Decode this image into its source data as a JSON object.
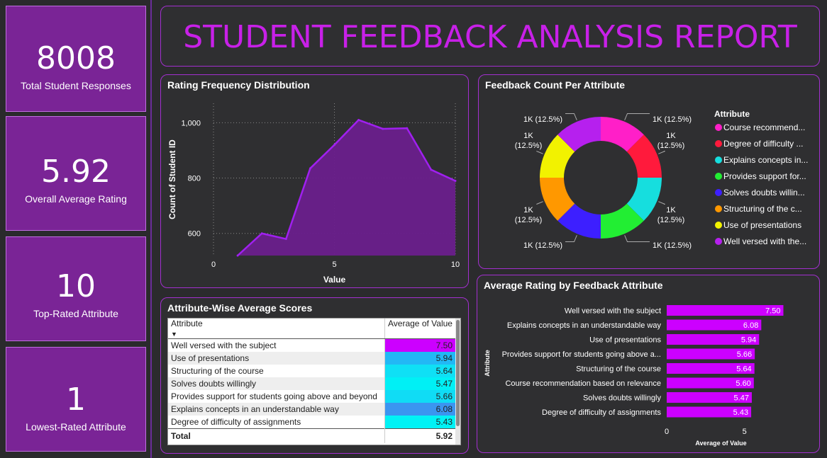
{
  "kpis": [
    {
      "value": "8008",
      "label": "Total Student Responses"
    },
    {
      "value": "5.92",
      "label": "Overall Average Rating"
    },
    {
      "value": "10",
      "label": "Top-Rated Attribute"
    },
    {
      "value": "1",
      "label": "Lowest-Rated Attribute"
    }
  ],
  "banner": {
    "title": "STUDENT FEEDBACK ANALYSIS REPORT"
  },
  "panels": {
    "area_title": "Rating Frequency Distribution",
    "donut_title": "Feedback Count Per Attribute",
    "table_title": "Attribute-Wise Average Scores",
    "bar_title": "Average Rating by Feedback Attribute"
  },
  "table": {
    "col1": "Attribute",
    "col2": "Average of Value",
    "rows": [
      {
        "attr": "Well versed with the subject",
        "value": "7.50",
        "color": "#cc00ff"
      },
      {
        "attr": "Use of presentations",
        "value": "5.94",
        "color": "#22b8f5"
      },
      {
        "attr": "Structuring of the course",
        "value": "5.64",
        "color": "#0fe0f5"
      },
      {
        "attr": "Solves doubts willingly",
        "value": "5.47",
        "color": "#00f0f5"
      },
      {
        "attr": "Provides support for students going above and beyond",
        "value": "5.66",
        "color": "#10dcf5"
      },
      {
        "attr": "Explains concepts in an understandable way",
        "value": "6.08",
        "color": "#3b95f0"
      },
      {
        "attr": "Degree of difficulty of assignments",
        "value": "5.43",
        "color": "#00f2f5"
      }
    ],
    "total_label": "Total",
    "total_value": "5.92"
  },
  "chart_data": [
    {
      "type": "area",
      "title": "Rating Frequency Distribution",
      "xlabel": "Value",
      "ylabel": "Count of Student ID",
      "x": [
        1,
        2,
        3,
        4,
        5,
        6,
        7,
        8,
        9,
        10
      ],
      "values": [
        520,
        600,
        580,
        835,
        920,
        1010,
        978,
        980,
        830,
        790
      ],
      "xlim": [
        0,
        10
      ],
      "ylim": [
        520,
        1070
      ],
      "x_ticks": [
        "0",
        "5",
        "10"
      ],
      "y_ticks": [
        "600",
        "800",
        "1,000"
      ],
      "color": "#a020f0",
      "grid": true
    },
    {
      "type": "pie",
      "title": "Feedback Count Per Attribute",
      "legend_title": "Attribute",
      "legend_position": "right",
      "slices": [
        {
          "name": "Course recommend...",
          "value": 12.5,
          "label": "1K (12.5%)",
          "color": "#ff1fc8"
        },
        {
          "name": "Degree of difficulty ...",
          "value": 12.5,
          "label": "1K (12.5%)",
          "color": "#ff1a3c"
        },
        {
          "name": "Explains concepts in...",
          "value": 12.5,
          "label": "1K (12.5%)",
          "color": "#16dede"
        },
        {
          "name": "Provides support for...",
          "value": 12.5,
          "label": "1K (12.5%)",
          "color": "#22ee33"
        },
        {
          "name": "Solves doubts willin...",
          "value": 12.5,
          "label": "1K (12.5%)",
          "color": "#3d1fff"
        },
        {
          "name": "Structuring of the c...",
          "value": 12.5,
          "label": "1K (12.5%)",
          "color": "#ff9800"
        },
        {
          "name": "Use of presentations",
          "value": 12.5,
          "label": "1K (12.5%)",
          "color": "#f2f200"
        },
        {
          "name": "Well versed with the...",
          "value": 12.5,
          "label": "1K (12.5%)",
          "color": "#b620ee"
        }
      ]
    },
    {
      "type": "bar",
      "orientation": "horizontal",
      "title": "Average Rating by Feedback Attribute",
      "xlabel": "Average of Value",
      "ylabel": "Attribute",
      "categories": [
        "Well versed with the subject",
        "Explains concepts in an understandable way",
        "Use of presentations",
        "Provides support for students going above a...",
        "Structuring of the course",
        "Course recommendation based on relevance",
        "Solves doubts willingly",
        "Degree of difficulty of assignments"
      ],
      "values": [
        7.5,
        6.08,
        5.94,
        5.66,
        5.64,
        5.6,
        5.47,
        5.43
      ],
      "value_labels": [
        "7.50",
        "6.08",
        "5.94",
        "5.66",
        "5.64",
        "5.60",
        "5.47",
        "5.43"
      ],
      "xlim": [
        0,
        8.8
      ],
      "x_ticks": [
        "0",
        "5"
      ],
      "color": "#cc00ff"
    }
  ]
}
